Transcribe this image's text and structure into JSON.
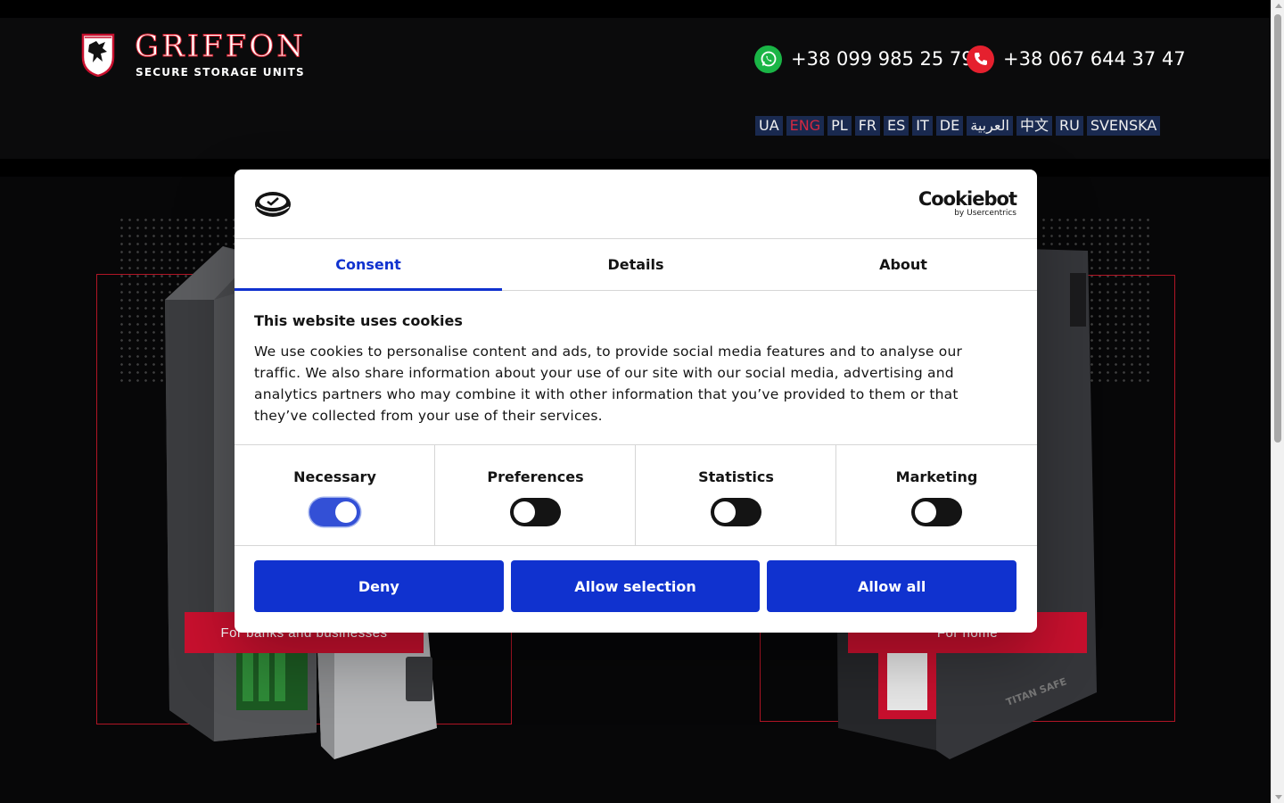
{
  "site": {
    "logo_title": "GRIFFON",
    "logo_subtitle": "SECURE STORAGE UNITS",
    "phones": [
      {
        "number": "+38 099 985 25 79",
        "icon": "whatsapp-icon"
      },
      {
        "number": "+38 067 644 37 47",
        "icon": "phone-icon"
      }
    ],
    "languages": [
      "UA",
      "ENG",
      "PL",
      "FR",
      "ES",
      "IT",
      "DE",
      "العربية",
      "中文",
      "RU",
      "SVENSKA"
    ],
    "active_language": "ENG",
    "categories": [
      "For banks and businesses",
      "For home"
    ],
    "safe_brand_label": "TITAN SAFE"
  },
  "cookie_dialog": {
    "brand": "Cookiebot",
    "brand_sub": "by Usercentrics",
    "tabs": [
      "Consent",
      "Details",
      "About"
    ],
    "active_tab": "Consent",
    "heading": "This website uses cookies",
    "text": "We use cookies to personalise content and ads, to provide social media features and to analyse our traffic. We also share information about your use of our site with our social media, advertising and analytics partners who may combine it with other information that you’ve provided to them or that they’ve collected from your use of their services.",
    "toggles": [
      {
        "label": "Necessary",
        "on": true
      },
      {
        "label": "Preferences",
        "on": false
      },
      {
        "label": "Statistics",
        "on": false
      },
      {
        "label": "Marketing",
        "on": false
      }
    ],
    "buttons": [
      "Deny",
      "Allow selection",
      "Allow all"
    ]
  },
  "colors": {
    "accent_blue": "#1032cf",
    "brand_red": "#c8102e",
    "lang_bg": "#1a2a50"
  }
}
